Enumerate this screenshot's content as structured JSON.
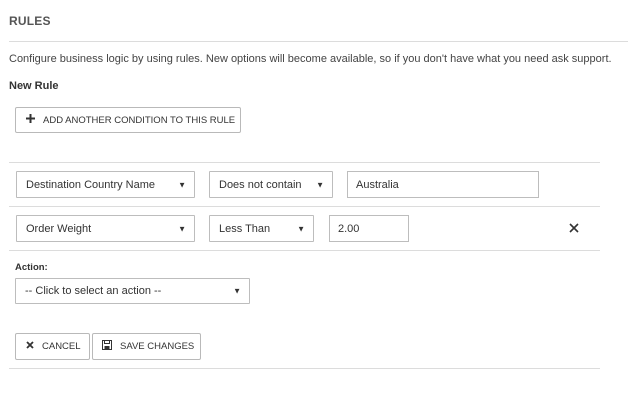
{
  "page": {
    "title": "RULES",
    "description": "Configure business logic by using rules. New options will become available, so if you don't have what you need ask support.",
    "section_title": "New Rule"
  },
  "buttons": {
    "add_condition": "ADD ANOTHER CONDITION TO THIS RULE",
    "cancel": "CANCEL",
    "save": "SAVE CHANGES"
  },
  "conditions": [
    {
      "field": "Destination Country Name",
      "operator": "Does not contain",
      "value": "Australia"
    },
    {
      "field": "Order Weight",
      "operator": "Less Than",
      "value": "2.00"
    }
  ],
  "action": {
    "label": "Action:",
    "placeholder": "-- Click to select an action --"
  },
  "icons": {
    "plus": "plus-icon",
    "remove": "close-icon",
    "caret": "caret-down-icon",
    "cancel": "close-icon",
    "save": "floppy-disk-icon"
  }
}
